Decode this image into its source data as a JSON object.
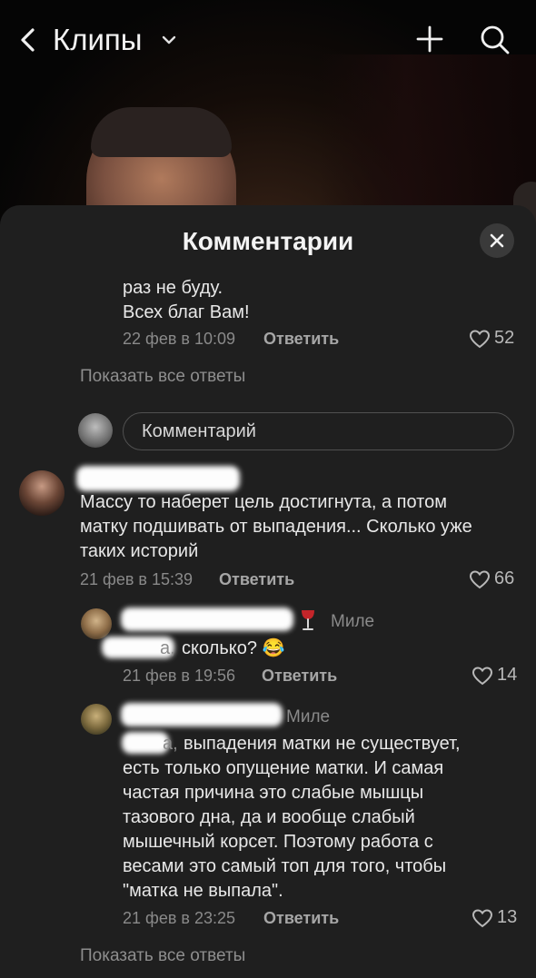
{
  "header": {
    "title": "Клипы"
  },
  "sheet": {
    "title": "Комментарии",
    "comment_placeholder": "Комментарий",
    "show_all_replies": "Показать все ответы"
  },
  "comments": [
    {
      "text": [
        "раз не буду.",
        "Всех благ Вам!"
      ],
      "date": "22 фев в 10:09",
      "reply_label": "Ответить",
      "likes": "52"
    },
    {
      "author_suffix": "ва",
      "text": [
        "Массу то наберет цель достигнута, а потом",
        "матку подшивать от выпадения... Сколько уже",
        "таких историй"
      ],
      "date": "21 фев в 15:39",
      "reply_label": "Ответить",
      "likes": "66"
    },
    {
      "author_suffix": "ва",
      "reply_to": "Миле",
      "text_prefix": "а,",
      "text": "сколько? 😂",
      "date": "21 фев в 19:56",
      "reply_label": "Ответить",
      "likes": "14"
    },
    {
      "author_suffix": "ва",
      "reply_to": "Миле",
      "text_prefix": "а,",
      "text": [
        "выпадения матки не существует,",
        "есть только опущение матки. И самая",
        "частая причина это слабые мышцы",
        "тазового дна, да и вообще слабый",
        "мышечный корсет. Поэтому работа с",
        "весами это самый топ для того, чтобы",
        "\"матка не выпала\"."
      ],
      "date": "21 фев в 23:25",
      "reply_label": "Ответить",
      "likes": "13"
    }
  ],
  "colors": {
    "sheet_bg": "#1f1f1f",
    "text": "#e8e8e8",
    "muted": "#8a8a8a"
  },
  "icons": [
    "back-chevron-icon",
    "dropdown-caret-icon",
    "plus-icon",
    "search-icon",
    "close-icon",
    "heart-icon",
    "wine-glass-icon"
  ]
}
